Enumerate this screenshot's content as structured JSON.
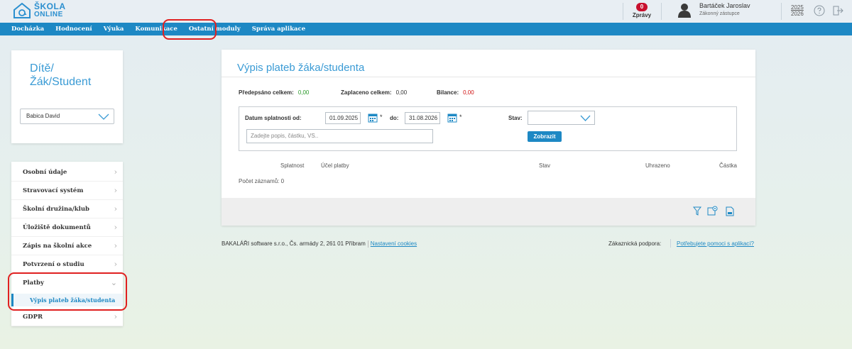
{
  "header": {
    "logo": {
      "line1": "ŠKOLA",
      "line2": "ONLINE"
    },
    "messages": {
      "count": "0",
      "label": "Zprávy"
    },
    "user": {
      "name": "Bartáček Jaroslav",
      "role": "Zákonný zástupce"
    },
    "school_year": {
      "top": "2025",
      "bottom": "2026"
    },
    "icons": [
      "house-at-icon",
      "user-avatar-icon",
      "help-icon",
      "logout-icon"
    ]
  },
  "nav": {
    "items": [
      "Docházka",
      "Hodnocení",
      "Výuka",
      "Komunikace",
      "Ostatní moduly",
      "Správa aplikace"
    ],
    "highlighted": "Ostatní moduly"
  },
  "child_panel": {
    "title_line1": "Dítě/",
    "title_line2": "Žák/Student",
    "selected_child": "Babica David"
  },
  "sidebar": {
    "items": [
      "Osobní údaje",
      "Stravovací systém",
      "Školní družina/klub",
      "Úložiště dokumentů",
      "Zápis na školní akce",
      "Potvrzení o studiu",
      "Platby",
      "GDPR"
    ],
    "expanded": "Platby",
    "sub_item": "Výpis plateb žáka/studenta"
  },
  "main": {
    "title": "Výpis plateb žáka/studenta",
    "summary": {
      "prescribed_label": "Předepsáno celkem:",
      "prescribed_value": "0,00",
      "paid_label": "Zaplaceno celkem:",
      "paid_value": "0,00",
      "balance_label": "Bilance:",
      "balance_value": "0,00"
    },
    "filter": {
      "date_from_label": "Datum splatnosti od:",
      "date_from": "01.09.2025",
      "date_to_label": "do:",
      "date_to": "31.08.2026",
      "required_mark": "*",
      "status_label": "Stav:",
      "status_value": "",
      "search_placeholder": "Zadejte popis, částku, VS..",
      "submit_label": "Zobrazit"
    },
    "table": {
      "columns": [
        "Splatnost",
        "Účel platby",
        "Stav",
        "Uhrazeno",
        "Částka"
      ],
      "rows": []
    },
    "record_count": "Počet záznamů: 0",
    "toolbar_icons": [
      "filter-icon",
      "column-settings-icon",
      "export-xls-icon"
    ]
  },
  "footer": {
    "company": "BAKALÁŘI software s.r.o., Čs. armády 2, 261 01 Příbram",
    "cookies_link": "Nastavení cookies",
    "support_label": "Zákaznická podpora:",
    "support_link": "Potřebujete pomoci s aplikací?"
  },
  "colors": {
    "accent": "#1d88c4",
    "title_blue": "#3a9bd5",
    "positive": "#2a9a2a",
    "negative": "#d01010",
    "badge": "#c8102e",
    "annotation": "#e02020"
  }
}
